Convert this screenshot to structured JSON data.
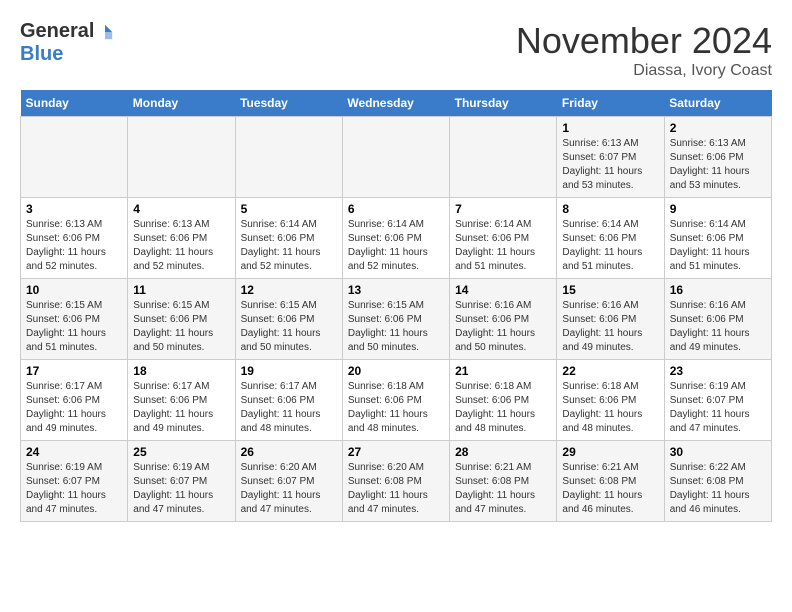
{
  "header": {
    "logo_general": "General",
    "logo_blue": "Blue",
    "month_title": "November 2024",
    "subtitle": "Diassa, Ivory Coast"
  },
  "days_of_week": [
    "Sunday",
    "Monday",
    "Tuesday",
    "Wednesday",
    "Thursday",
    "Friday",
    "Saturday"
  ],
  "weeks": [
    {
      "days": [
        {
          "num": "",
          "content": ""
        },
        {
          "num": "",
          "content": ""
        },
        {
          "num": "",
          "content": ""
        },
        {
          "num": "",
          "content": ""
        },
        {
          "num": "",
          "content": ""
        },
        {
          "num": "1",
          "content": "Sunrise: 6:13 AM\nSunset: 6:07 PM\nDaylight: 11 hours and 53 minutes."
        },
        {
          "num": "2",
          "content": "Sunrise: 6:13 AM\nSunset: 6:06 PM\nDaylight: 11 hours and 53 minutes."
        }
      ]
    },
    {
      "days": [
        {
          "num": "3",
          "content": "Sunrise: 6:13 AM\nSunset: 6:06 PM\nDaylight: 11 hours and 52 minutes."
        },
        {
          "num": "4",
          "content": "Sunrise: 6:13 AM\nSunset: 6:06 PM\nDaylight: 11 hours and 52 minutes."
        },
        {
          "num": "5",
          "content": "Sunrise: 6:14 AM\nSunset: 6:06 PM\nDaylight: 11 hours and 52 minutes."
        },
        {
          "num": "6",
          "content": "Sunrise: 6:14 AM\nSunset: 6:06 PM\nDaylight: 11 hours and 52 minutes."
        },
        {
          "num": "7",
          "content": "Sunrise: 6:14 AM\nSunset: 6:06 PM\nDaylight: 11 hours and 51 minutes."
        },
        {
          "num": "8",
          "content": "Sunrise: 6:14 AM\nSunset: 6:06 PM\nDaylight: 11 hours and 51 minutes."
        },
        {
          "num": "9",
          "content": "Sunrise: 6:14 AM\nSunset: 6:06 PM\nDaylight: 11 hours and 51 minutes."
        }
      ]
    },
    {
      "days": [
        {
          "num": "10",
          "content": "Sunrise: 6:15 AM\nSunset: 6:06 PM\nDaylight: 11 hours and 51 minutes."
        },
        {
          "num": "11",
          "content": "Sunrise: 6:15 AM\nSunset: 6:06 PM\nDaylight: 11 hours and 50 minutes."
        },
        {
          "num": "12",
          "content": "Sunrise: 6:15 AM\nSunset: 6:06 PM\nDaylight: 11 hours and 50 minutes."
        },
        {
          "num": "13",
          "content": "Sunrise: 6:15 AM\nSunset: 6:06 PM\nDaylight: 11 hours and 50 minutes."
        },
        {
          "num": "14",
          "content": "Sunrise: 6:16 AM\nSunset: 6:06 PM\nDaylight: 11 hours and 50 minutes."
        },
        {
          "num": "15",
          "content": "Sunrise: 6:16 AM\nSunset: 6:06 PM\nDaylight: 11 hours and 49 minutes."
        },
        {
          "num": "16",
          "content": "Sunrise: 6:16 AM\nSunset: 6:06 PM\nDaylight: 11 hours and 49 minutes."
        }
      ]
    },
    {
      "days": [
        {
          "num": "17",
          "content": "Sunrise: 6:17 AM\nSunset: 6:06 PM\nDaylight: 11 hours and 49 minutes."
        },
        {
          "num": "18",
          "content": "Sunrise: 6:17 AM\nSunset: 6:06 PM\nDaylight: 11 hours and 49 minutes."
        },
        {
          "num": "19",
          "content": "Sunrise: 6:17 AM\nSunset: 6:06 PM\nDaylight: 11 hours and 48 minutes."
        },
        {
          "num": "20",
          "content": "Sunrise: 6:18 AM\nSunset: 6:06 PM\nDaylight: 11 hours and 48 minutes."
        },
        {
          "num": "21",
          "content": "Sunrise: 6:18 AM\nSunset: 6:06 PM\nDaylight: 11 hours and 48 minutes."
        },
        {
          "num": "22",
          "content": "Sunrise: 6:18 AM\nSunset: 6:06 PM\nDaylight: 11 hours and 48 minutes."
        },
        {
          "num": "23",
          "content": "Sunrise: 6:19 AM\nSunset: 6:07 PM\nDaylight: 11 hours and 47 minutes."
        }
      ]
    },
    {
      "days": [
        {
          "num": "24",
          "content": "Sunrise: 6:19 AM\nSunset: 6:07 PM\nDaylight: 11 hours and 47 minutes."
        },
        {
          "num": "25",
          "content": "Sunrise: 6:19 AM\nSunset: 6:07 PM\nDaylight: 11 hours and 47 minutes."
        },
        {
          "num": "26",
          "content": "Sunrise: 6:20 AM\nSunset: 6:07 PM\nDaylight: 11 hours and 47 minutes."
        },
        {
          "num": "27",
          "content": "Sunrise: 6:20 AM\nSunset: 6:08 PM\nDaylight: 11 hours and 47 minutes."
        },
        {
          "num": "28",
          "content": "Sunrise: 6:21 AM\nSunset: 6:08 PM\nDaylight: 11 hours and 47 minutes."
        },
        {
          "num": "29",
          "content": "Sunrise: 6:21 AM\nSunset: 6:08 PM\nDaylight: 11 hours and 46 minutes."
        },
        {
          "num": "30",
          "content": "Sunrise: 6:22 AM\nSunset: 6:08 PM\nDaylight: 11 hours and 46 minutes."
        }
      ]
    }
  ]
}
